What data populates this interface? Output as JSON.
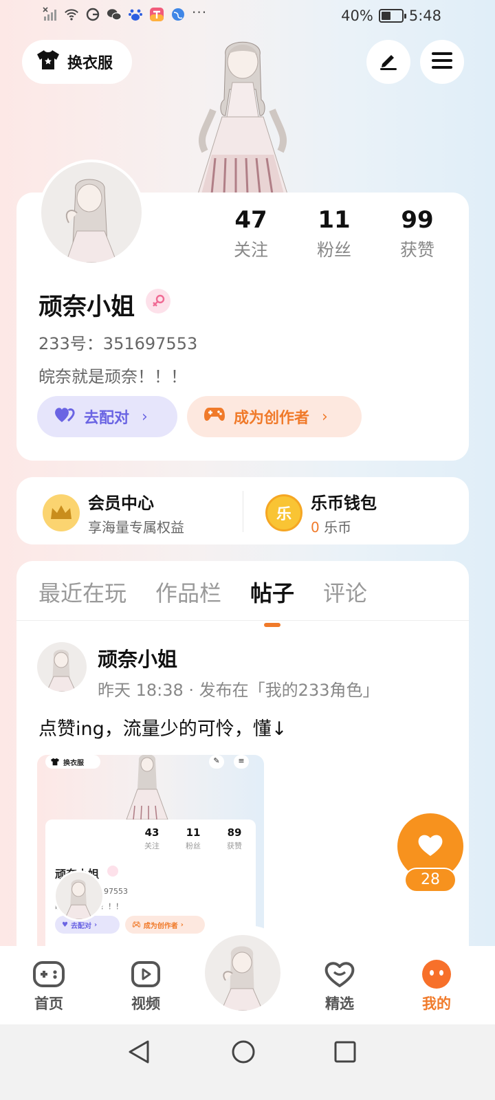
{
  "status_bar": {
    "battery_percent": "40%",
    "battery_level": 0.4,
    "time": "5:48",
    "icons": [
      "no-signal-icon",
      "wifi-icon",
      "sync-icon",
      "wechat-icon",
      "baidu-icon",
      "app-icon",
      "globe-icon",
      "more-icon"
    ],
    "more": "···"
  },
  "header": {
    "outfit_label": "换衣服",
    "edit_icon": "pen-icon",
    "menu_icon": "hamburger-icon"
  },
  "profile": {
    "name": "顽奈小姐",
    "gender": "female",
    "uid_label": "233号：351697553",
    "bio": "皖奈就是顽奈！！！",
    "stats": [
      {
        "value": "47",
        "label": "关注"
      },
      {
        "value": "11",
        "label": "粉丝"
      },
      {
        "value": "99",
        "label": "获赞"
      }
    ],
    "match_label": "去配对",
    "creator_label": "成为创作者",
    "chevron": "›"
  },
  "member": {
    "title": "会员中心",
    "subtitle": "享海量专属权益"
  },
  "wallet": {
    "title": "乐币钱包",
    "balance": "0",
    "unit": "乐币",
    "coin_char": "乐"
  },
  "tabs": [
    {
      "label": "最近在玩",
      "active": false
    },
    {
      "label": "作品栏",
      "active": false
    },
    {
      "label": "帖子",
      "active": true
    },
    {
      "label": "评论",
      "active": false
    }
  ],
  "post": {
    "author": "顽奈小姐",
    "meta": "昨天 18:38 · 发布在「我的233角色」",
    "text": "点赞ing，流量少的可怜，懂↓",
    "like_count": "28",
    "image": {
      "outfit_label": "换衣服",
      "name": "顽奈小姐",
      "uid_label": "233号：351697553",
      "bio": "皖奈就是顽奈！！！",
      "stats": [
        {
          "value": "43",
          "label": "关注"
        },
        {
          "value": "11",
          "label": "粉丝"
        },
        {
          "value": "89",
          "label": "获赞"
        }
      ],
      "match_label": "去配对",
      "creator_label": "成为创作者"
    }
  },
  "bottom_nav": [
    {
      "label": "首页",
      "icon": "gamepad-icon",
      "active": false
    },
    {
      "label": "视频",
      "icon": "play-icon",
      "active": false
    },
    {
      "label": "精选",
      "icon": "heart-icon",
      "active": false
    },
    {
      "label": "我的",
      "icon": "face-icon",
      "active": true
    }
  ],
  "colors": {
    "accent": "#f07a2a",
    "like": "#f7921e",
    "match": "#6a64e3"
  }
}
